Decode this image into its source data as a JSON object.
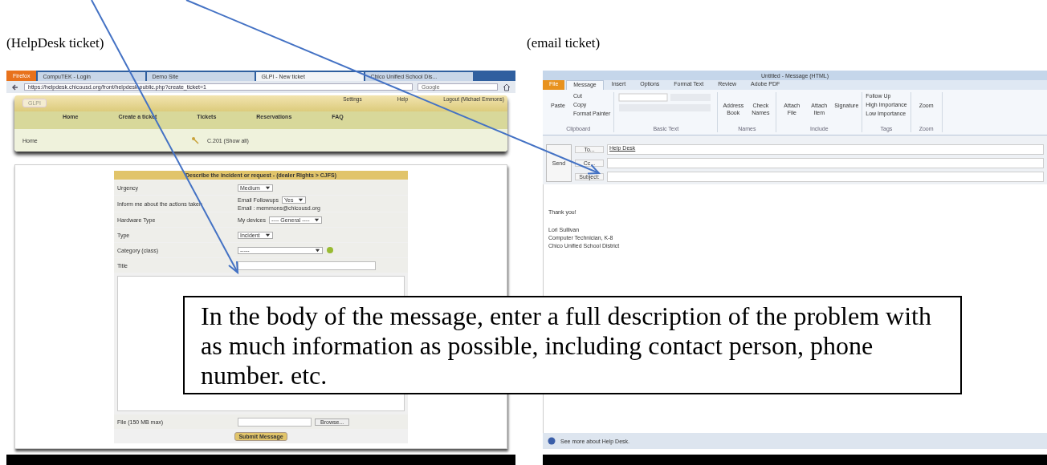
{
  "captions": [
    {
      "text": "(HelpDesk ticket)"
    },
    {
      "text": "(email ticket)"
    }
  ],
  "helpdesk": {
    "firefox_button": "Firefox",
    "browser_tabs": [
      {
        "label": "CompuTEK - Login",
        "selected": false
      },
      {
        "label": "Demo Site",
        "selected": false
      },
      {
        "label": "GLPI - New ticket",
        "selected": true
      },
      {
        "label": "Chico Unified School Dis...",
        "selected": false
      }
    ],
    "url": "https://helpdesk.chicousd.org/front/helpdesk.public.php?create_ticket=1",
    "search_placeholder": "Google",
    "logo": "GLPI",
    "top_links": [
      "Settings",
      "Help",
      "Logout (Michael Emmons)"
    ],
    "nav": [
      "Home",
      "Create a ticket",
      "Tickets",
      "Reservations",
      "FAQ"
    ],
    "breadcrumb": "Home",
    "entity": "C.201 (Show all)",
    "form": {
      "title": "Describe the incident or request - (dealer Rights > CJFS)",
      "fields": [
        {
          "kind": "select",
          "label": "Urgency",
          "value": "Medium"
        },
        {
          "kind": "followup",
          "label": "Inform me about the actions taken",
          "prefix": "Email Followups",
          "value": "Yes",
          "note": "Email : memmons@chicousd.org"
        },
        {
          "kind": "device",
          "label": "Hardware Type",
          "prefix": "My devices",
          "value": "---- General ----"
        },
        {
          "kind": "select",
          "label": "Type",
          "value": "Incident"
        },
        {
          "kind": "category",
          "label": "Category (class)",
          "value": "-----"
        },
        {
          "kind": "input",
          "label": "Title"
        }
      ],
      "file_label": "File (150 MB max)",
      "browse": "Browse...",
      "submit": "Submit Message"
    }
  },
  "email": {
    "window_title": "Untitled - Message (HTML)",
    "ribbon_tabs": [
      {
        "label": "File",
        "selected": false
      },
      {
        "label": "Message",
        "selected": true
      },
      {
        "label": "Insert",
        "selected": false
      },
      {
        "label": "Options",
        "selected": false
      },
      {
        "label": "Format Text",
        "selected": false
      },
      {
        "label": "Review",
        "selected": false
      },
      {
        "label": "Adobe PDF",
        "selected": false
      }
    ],
    "clipboard": {
      "paste": "Paste",
      "cut": "Cut",
      "copy": "Copy",
      "format_painter": "Format Painter"
    },
    "groups": [
      "Clipboard",
      "Basic Text",
      "Names",
      "Include",
      "Tags",
      "Zoom"
    ],
    "big_buttons": [
      "Address Book",
      "Check Names",
      "Attach File",
      "Attach Item",
      "Signature"
    ],
    "tags": [
      "Follow Up",
      "High Importance",
      "Low Importance"
    ],
    "zoom": "Zoom",
    "send": "Send",
    "to_button": "To...",
    "cc_button": "Cc...",
    "subject_label": "Subject:",
    "to_value": "Help Desk",
    "body": [
      "Thank you!",
      "Lori Sullivan",
      "Computer Technician, K-8",
      "Chico Unified School District"
    ],
    "status": "See more about Help Desk."
  },
  "callout": {
    "text": "In the body of the message, enter a full description of the problem with as much information as possible, including contact person, phone number. etc."
  }
}
